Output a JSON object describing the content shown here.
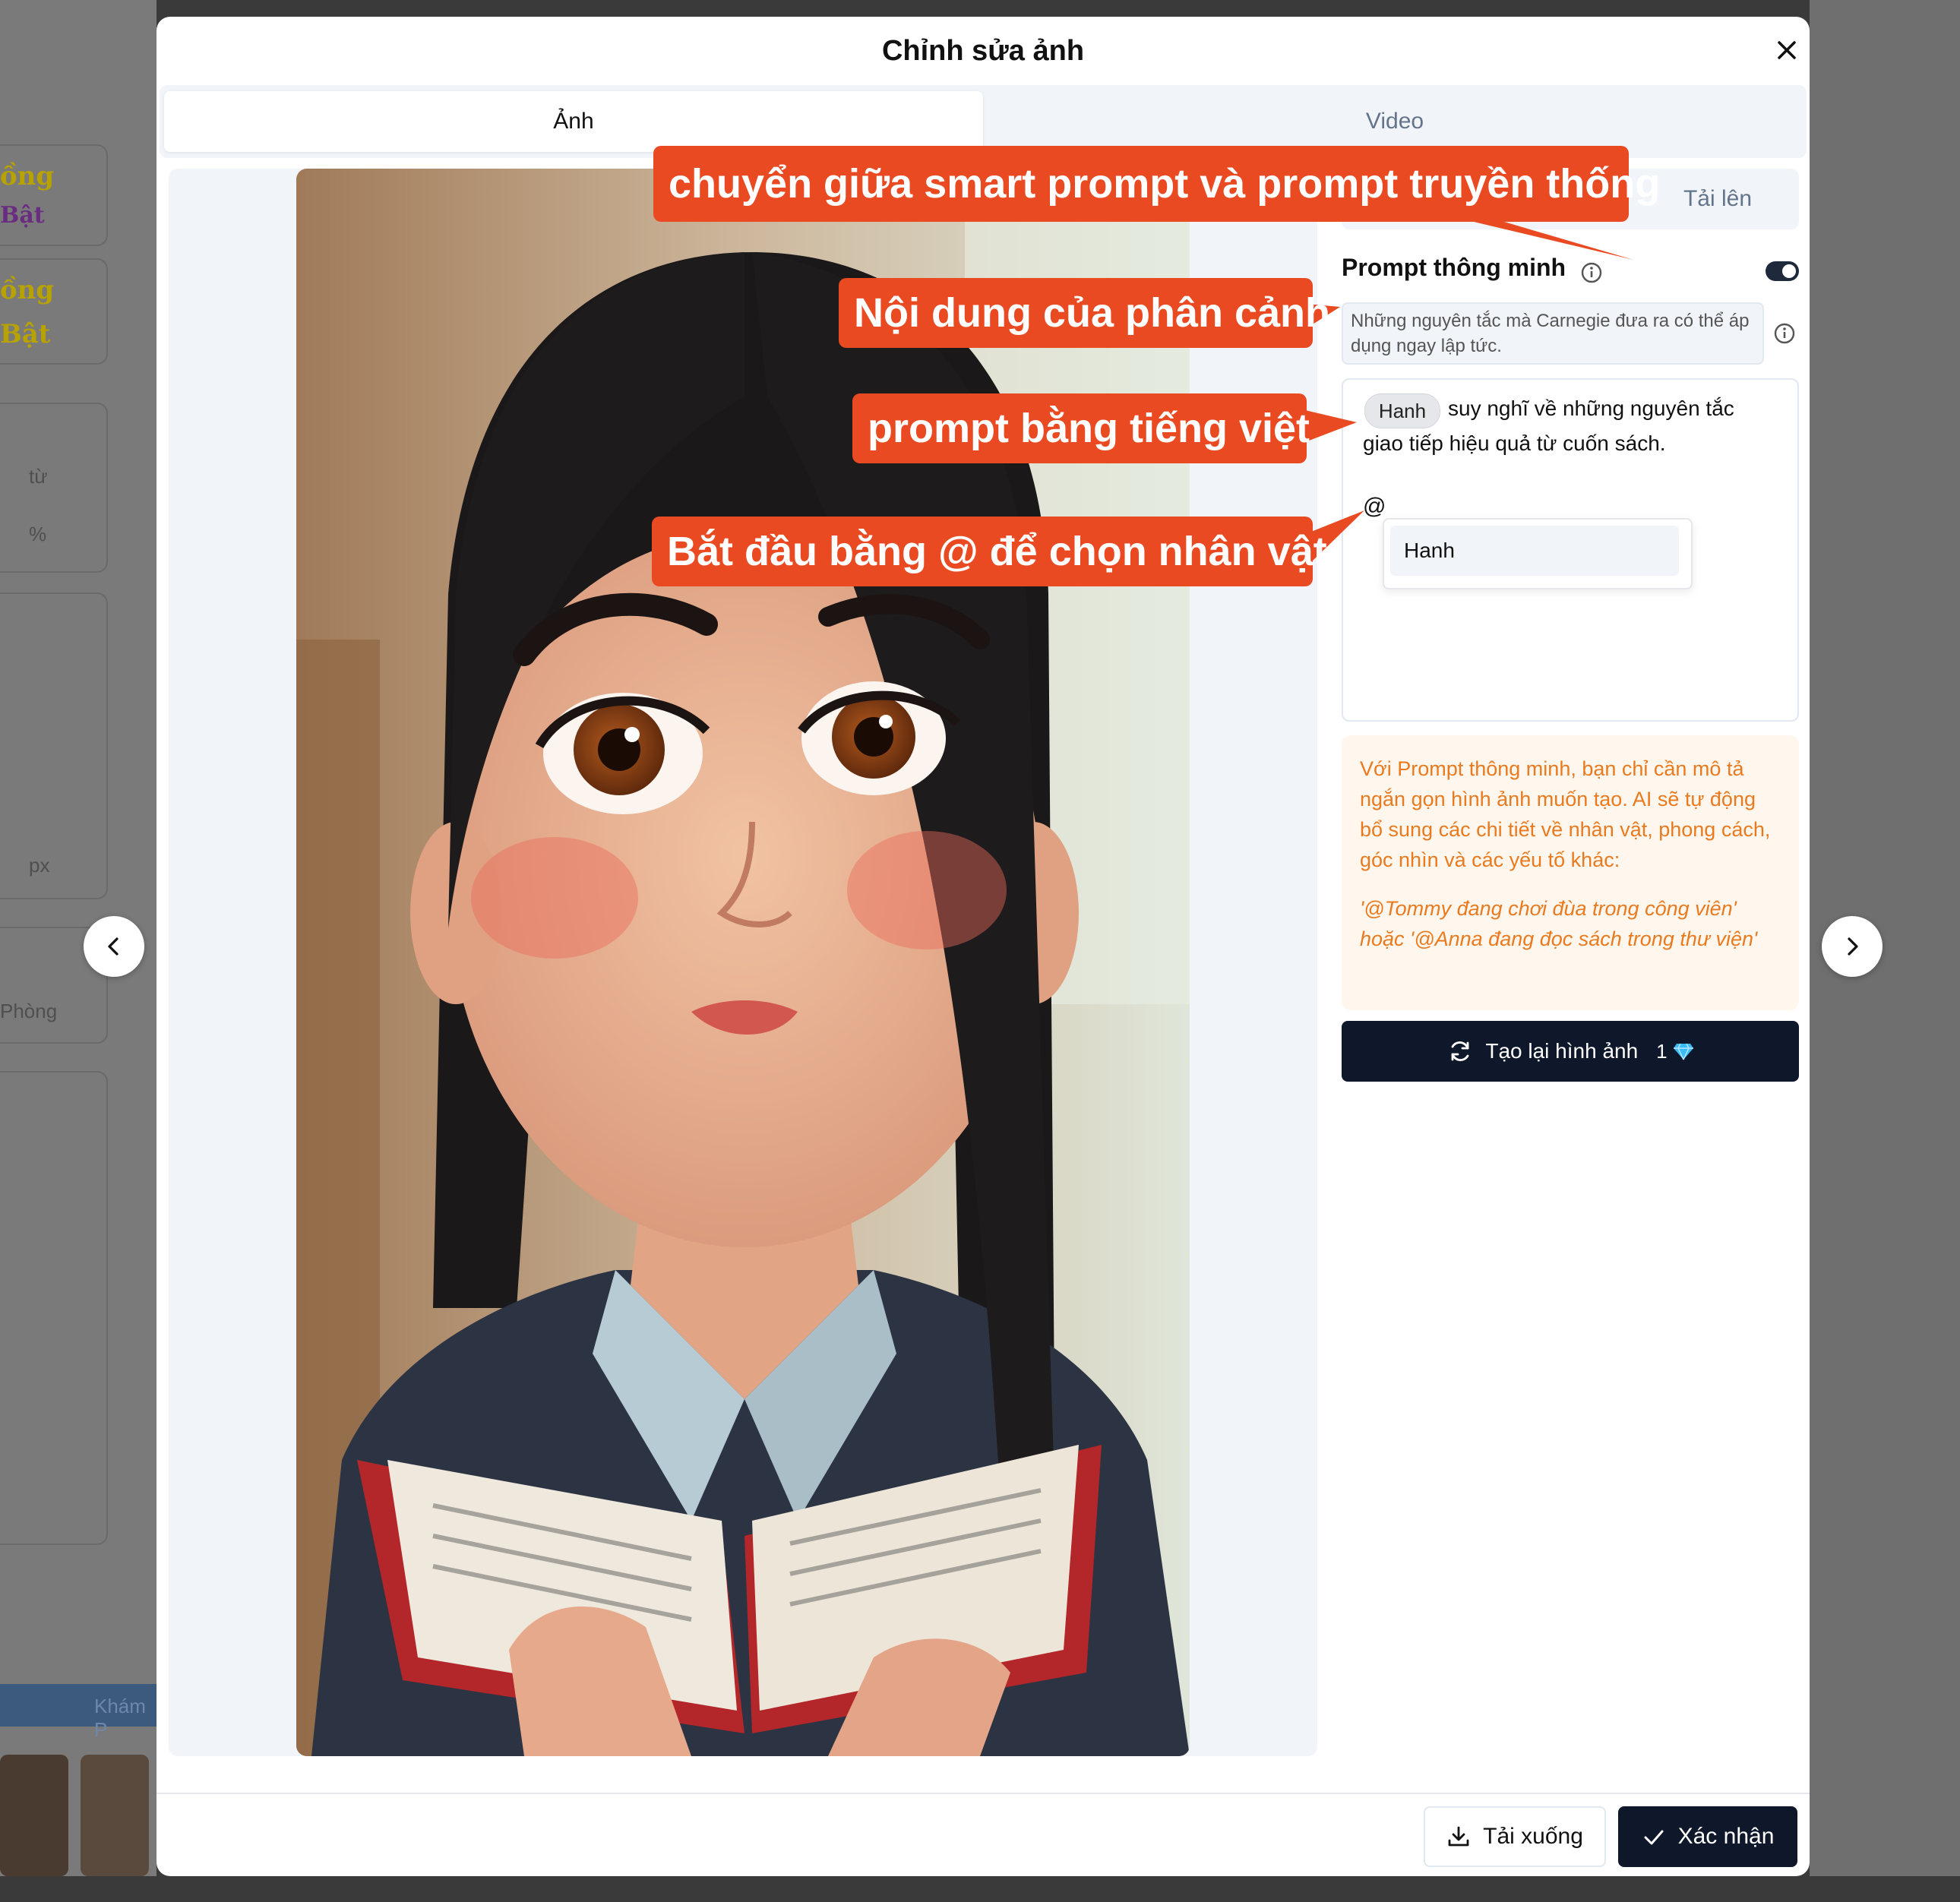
{
  "modal": {
    "title": "Chỉnh sửa ảnh",
    "tabs": [
      "Ảnh",
      "Video"
    ]
  },
  "panel": {
    "upload_tab": "Tải lên",
    "smart_prompt_label": "Prompt thông minh",
    "smart_prompt_enabled": true,
    "scene_text": "Những nguyên tắc mà Carnegie đưa ra có thể áp dụng ngay lập tức.",
    "mention_chip": "Hanh",
    "prompt_line1": "suy nghĩ về những nguyên tắc",
    "prompt_line2": "giao tiếp hiệu quả từ cuốn sách.",
    "prompt_at": "@",
    "mention_options": [
      "Hanh"
    ],
    "hint_text": "Với Prompt thông minh, bạn chỉ cần mô tả ngắn gọn hình ảnh muốn tạo. AI sẽ tự động bổ sung các chi tiết về nhân vật, phong cách, góc nhìn và các yếu tố khác:",
    "hint_example": "'@Tommy đang chơi đùa trong công viên' hoặc '@Anna đang đọc sách trong thư viện'",
    "regen_label": "Tạo lại hình ảnh",
    "regen_cost": "1"
  },
  "footer": {
    "download_label": "Tải xuống",
    "confirm_label": "Xác nhận"
  },
  "callouts": {
    "toggle_note": "chuyển giữa smart prompt và prompt truyền thống",
    "scene_note": "Nội dung của phân cảnh",
    "prompt_note": "prompt bằng tiếng việt",
    "mention_note": "Bắt đầu bằng @ để chọn nhân vật"
  },
  "background": {
    "left_texts": [
      "ồng",
      "Bật",
      "ồng",
      "Bật",
      "từ",
      "%",
      "px",
      "Phòng",
      "Khám P"
    ]
  },
  "colors": {
    "accent_dark": "#0f172a",
    "callout": "#ea4a22",
    "hint_text": "#ea7a1f",
    "hint_bg": "#fff7ed",
    "gem": "#38bdf8"
  },
  "icons": {
    "close": "close-icon",
    "prev": "chevron-left-icon",
    "next": "chevron-right-icon",
    "info": "info-icon",
    "refresh": "refresh-icon",
    "gem": "gem-icon",
    "download": "download-icon",
    "check": "check-icon"
  }
}
